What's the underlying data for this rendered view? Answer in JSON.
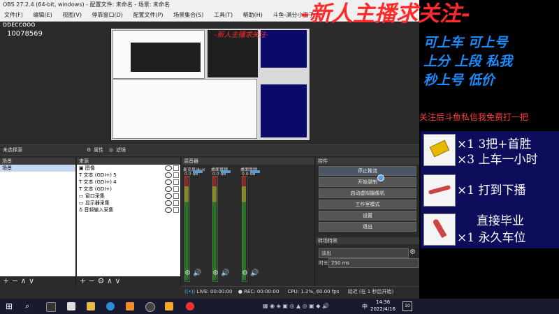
{
  "obs": {
    "title": "OBS 27.2.4 (64-bit, windows) - 配置文件: 未命名 - 场景: 未命名",
    "menu": [
      "文件(F)",
      "编辑(E)",
      "视图(V)",
      "停靠窗口(D)",
      "配置文件(P)",
      "场景集合(S)",
      "工具(T)",
      "帮助(H)",
      "斗鱼-满分小王子"
    ],
    "watermark": "10078569",
    "no_source": "未选择源",
    "props_btn": "属性",
    "filters_btn": "滤镜",
    "scenes": {
      "title": "场景",
      "items": [
        "场景"
      ]
    },
    "sources": {
      "title": "来源",
      "items": [
        "图像",
        "文本 (GDI+) 5",
        "文本 (GDI+) 4",
        "文本 (GDI+)",
        "窗口采集",
        "显示器采集",
        "音频输入采集"
      ]
    },
    "mixer": {
      "title": "混音器",
      "channels": [
        "麦克风/Aux",
        "桌面音频",
        "桌面音频"
      ],
      "db": "0.0 dB"
    },
    "controls": {
      "title": "控件",
      "buttons": [
        "停止推流",
        "开始录制",
        "启动虚拟摄像机",
        "工作室模式",
        "设置",
        "退出"
      ]
    },
    "transitions": {
      "title": "转场特效",
      "type": "淡出",
      "duration_label": "时长",
      "duration": "250 ms"
    },
    "status": {
      "live": "LIVE: 00:00:00",
      "rec": "REC: 00:00:00",
      "cpu": "CPU: 1.2%, 60.00 fps",
      "delay": "延迟 (在 1 秒后开始)"
    }
  },
  "overlay": {
    "banner": "-新人主播求关注-",
    "promo": [
      "可上车 可上号",
      "上分 上段 私我",
      "秒上号 低价"
    ],
    "follow": "关注后斗鱼私信我免费打一把",
    "gifts": [
      {
        "line1": "×1 3把+首胜",
        "line2": "×3 上车一小时",
        "icon": "gold-card-icon"
      },
      {
        "line1": "×1 打到下播",
        "line2": "",
        "icon": "jet-icon"
      },
      {
        "line1": "直接毕业",
        "line2": "×1 永久车位",
        "icon": "rocket-icon"
      }
    ]
  },
  "taskbar": {
    "time": "14:36",
    "date": "2022/4/16",
    "lang": "中",
    "notif": "10"
  },
  "colors": {
    "banner": "#ff2a2a",
    "promo": "#1a8cff",
    "gift_bg": "#0d0d5c"
  }
}
